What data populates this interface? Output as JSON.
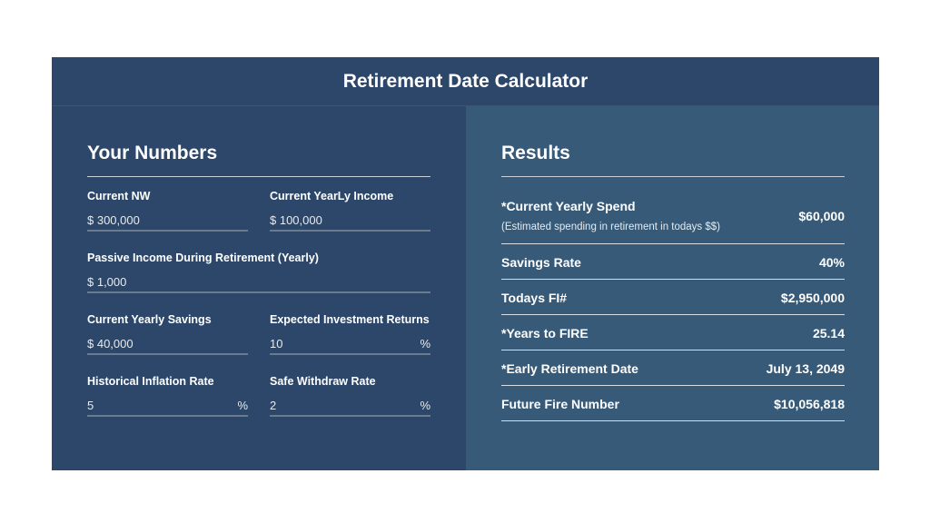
{
  "title": "Retirement Date Calculator",
  "inputs": {
    "heading": "Your Numbers",
    "fields": [
      {
        "label": "Current NW",
        "value": "$ 300,000",
        "suffix": ""
      },
      {
        "label": "Current YearLy Income",
        "value": "$ 100,000",
        "suffix": ""
      },
      {
        "label": "Passive Income During Retirement (Yearly)",
        "value": "$ 1,000",
        "suffix": ""
      },
      {
        "label": "Current Yearly Savings",
        "value": "$ 40,000",
        "suffix": ""
      },
      {
        "label": "Expected Investment Returns",
        "value": "10",
        "suffix": "%"
      },
      {
        "label": "Historical Inflation Rate",
        "value": "5",
        "suffix": "%"
      },
      {
        "label": "Safe Withdraw Rate",
        "value": "2",
        "suffix": "%"
      }
    ]
  },
  "results": {
    "heading": "Results",
    "rows": [
      {
        "label": "*Current Yearly Spend",
        "sub": "(Estimated spending in retirement in todays $$)",
        "value": "$60,000"
      },
      {
        "label": "Savings Rate",
        "value": "40%"
      },
      {
        "label": "Todays FI#",
        "value": "$2,950,000"
      },
      {
        "label": "*Years to FIRE",
        "value": "25.14"
      },
      {
        "label": "*Early Retirement Date",
        "value": "July 13, 2049"
      },
      {
        "label": "Future Fire Number",
        "value": "$10,056,818"
      }
    ]
  }
}
